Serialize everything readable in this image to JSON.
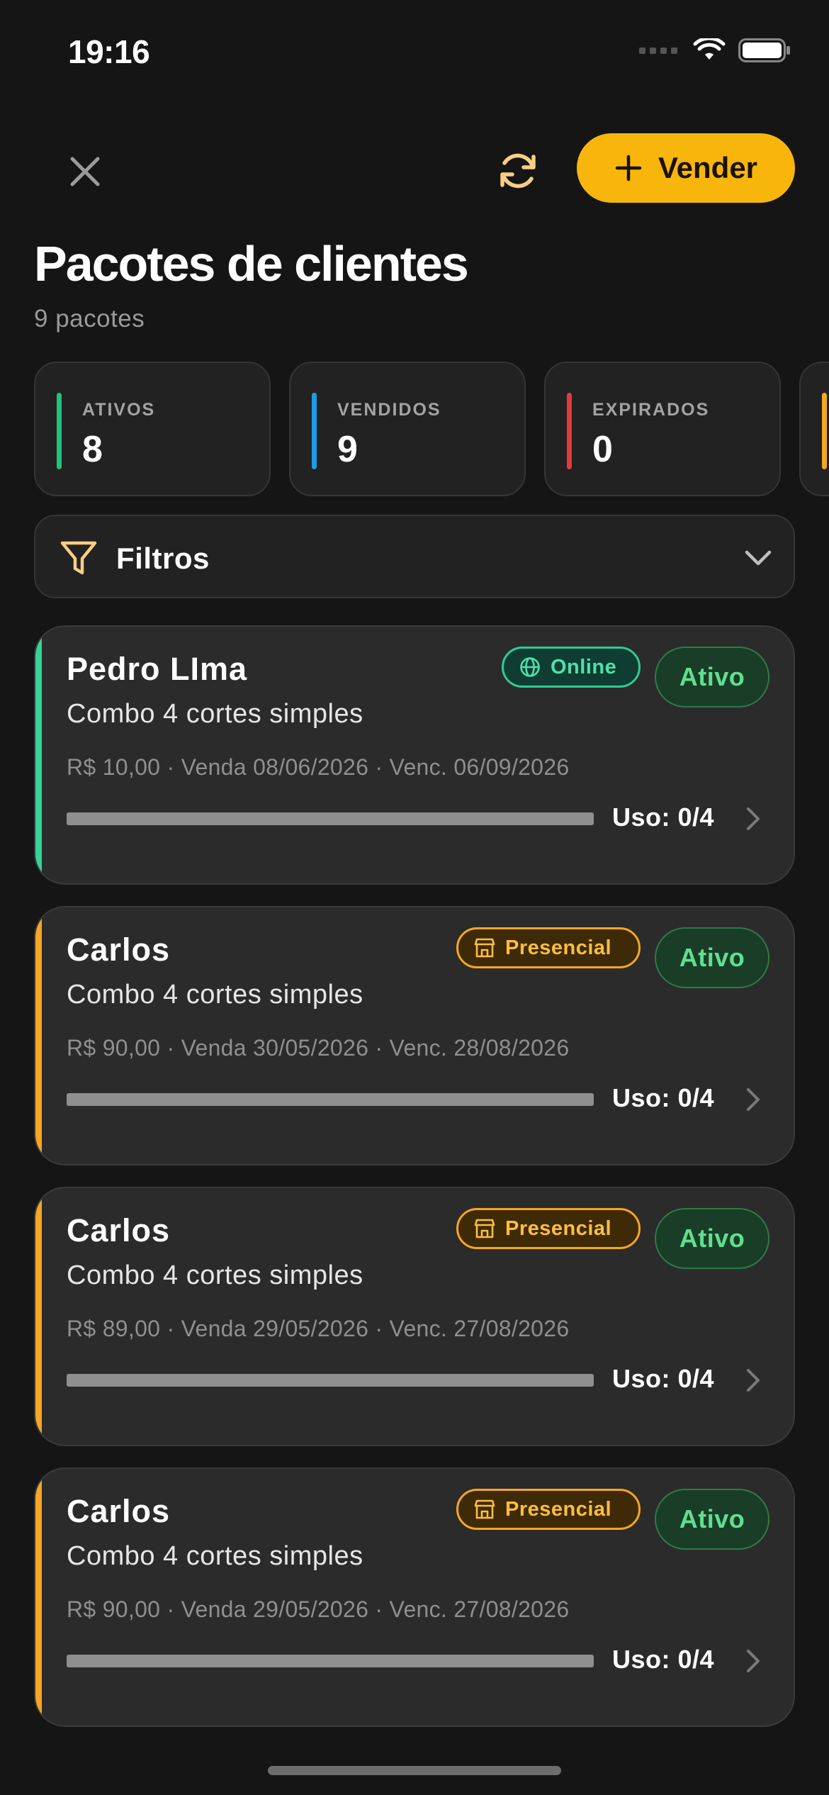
{
  "status_bar": {
    "time": "19:16"
  },
  "header": {
    "sell_label": "Vender"
  },
  "page": {
    "title": "Pacotes de clientes",
    "subtitle": "9 pacotes"
  },
  "stats": [
    {
      "label": "ATIVOS",
      "value": "8",
      "color": "#22c27a"
    },
    {
      "label": "VENDIDOS",
      "value": "9",
      "color": "#1e9be6"
    },
    {
      "label": "EXPIRADOS",
      "value": "0",
      "color": "#e5393b"
    },
    {
      "label": "",
      "value": "",
      "color": "#f5a623"
    }
  ],
  "filters": {
    "label": "Filtros"
  },
  "colors": {
    "accent": "#f8b60d",
    "online": "#2ecc94",
    "presencial": "#f5a623",
    "active": "#5fe08f"
  },
  "packages": [
    {
      "client": "Pedro LIma",
      "product": "Combo 4 cortes simples",
      "meta": "R$ 10,00 · Venda 08/06/2026 · Venc. 06/09/2026",
      "usage": "Uso: 0/4",
      "usage_fraction": 0,
      "channel": "Online",
      "channel_type": "online",
      "channel_icon": "globe-icon",
      "status": "Ativo",
      "accent": "#34d399"
    },
    {
      "client": "Carlos",
      "product": "Combo 4 cortes simples",
      "meta": "R$ 90,00 · Venda 30/05/2026 · Venc. 28/08/2026",
      "usage": "Uso: 0/4",
      "usage_fraction": 0,
      "channel": "Presencial",
      "channel_type": "presencial",
      "channel_icon": "store-icon",
      "status": "Ativo",
      "accent": "#f5a623"
    },
    {
      "client": "Carlos",
      "product": "Combo 4 cortes simples",
      "meta": "R$ 89,00 · Venda 29/05/2026 · Venc. 27/08/2026",
      "usage": "Uso: 0/4",
      "usage_fraction": 0,
      "channel": "Presencial",
      "channel_type": "presencial",
      "channel_icon": "store-icon",
      "status": "Ativo",
      "accent": "#f5a623"
    },
    {
      "client": "Carlos",
      "product": "Combo 4 cortes simples",
      "meta": "R$ 90,00 · Venda 29/05/2026 · Venc. 27/08/2026",
      "usage": "Uso: 0/4",
      "usage_fraction": 0,
      "channel": "Presencial",
      "channel_type": "presencial",
      "channel_icon": "store-icon",
      "status": "Ativo",
      "accent": "#f5a623"
    }
  ]
}
